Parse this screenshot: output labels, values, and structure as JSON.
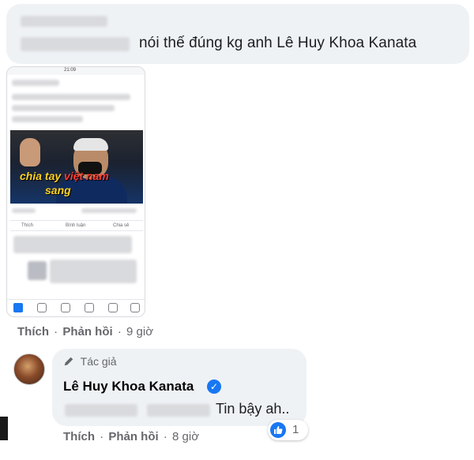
{
  "top_comment": {
    "text": "nói thế đúng kg anh Lê Huy Khoa Kanata"
  },
  "attachment": {
    "status_time": "21:09",
    "caption_line1_a": "chia tay",
    "caption_line1_b": "việt nam",
    "caption_line2": "sang",
    "actions": [
      "Thích",
      "Bình luận",
      "Chia sẻ"
    ]
  },
  "first_meta": {
    "like": "Thích",
    "reply": "Phản hồi",
    "time": "9 giờ",
    "separator": "·"
  },
  "reply": {
    "badge": "Tác giả",
    "name": "Lê Huy Khoa Kanata",
    "text": "Tin bậy ah..",
    "reaction_count": "1"
  },
  "second_meta": {
    "like": "Thích",
    "reply": "Phản hồi",
    "time": "8 giờ",
    "separator": "·"
  },
  "icons": {
    "verified": "verified-check-icon",
    "author": "pen-icon",
    "reaction": "like-thumb-icon"
  },
  "colors": {
    "bubble": "#eff2f5",
    "meta_text": "#65676b",
    "facebook_blue": "#1877f2"
  }
}
